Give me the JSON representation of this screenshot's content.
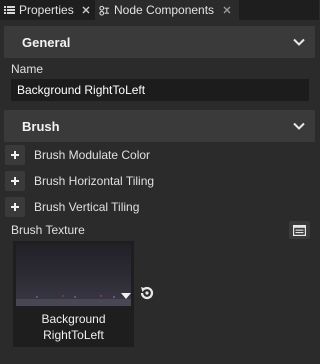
{
  "tabs": [
    {
      "label": "Properties",
      "icon": "list-icon",
      "active": false
    },
    {
      "label": "Node Components",
      "icon": "node-components-icon",
      "active": true
    }
  ],
  "sections": {
    "general": {
      "title": "General"
    },
    "brush": {
      "title": "Brush"
    }
  },
  "name_field": {
    "label": "Name",
    "value": "Background RightToLeft"
  },
  "brush_properties": [
    {
      "label": "Brush Modulate Color"
    },
    {
      "label": "Brush Horizontal Tiling"
    },
    {
      "label": "Brush Vertical Tiling"
    }
  ],
  "brush_texture": {
    "label": "Brush Texture",
    "name": "Background RightToLeft"
  },
  "colors": {
    "panel_bg": "#2b2b2b",
    "tabbar_bg": "#1e1e1e",
    "section_bg": "#3a3a3a",
    "field_bg": "#1c1c1c"
  }
}
